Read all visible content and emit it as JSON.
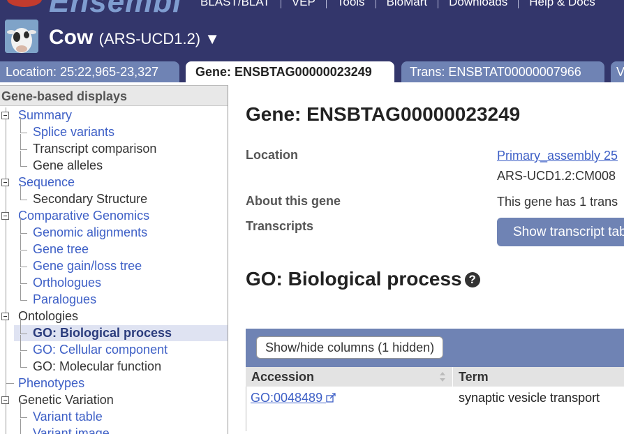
{
  "header": {
    "logo_text": "Ensembl",
    "nav": [
      "BLAST/BLAT",
      "VEP",
      "Tools",
      "BioMart",
      "Downloads",
      "Help & Docs"
    ],
    "species": "Cow",
    "assembly": "(ARS-UCD1.2) ▼"
  },
  "tabs": [
    {
      "label": "Location: 25:22,965-23,327",
      "active": false
    },
    {
      "label": "Gene: ENSBTAG00000023249",
      "active": true
    },
    {
      "label": "Trans: ENSBTAT00000007966",
      "active": false
    },
    {
      "label": "V",
      "active": false
    }
  ],
  "sidebar": {
    "header": "Gene-based displays",
    "items": [
      {
        "label": "Summary",
        "level": 0,
        "link": true
      },
      {
        "label": "Splice variants",
        "level": 1,
        "link": true
      },
      {
        "label": "Transcript comparison",
        "level": 1,
        "link": false
      },
      {
        "label": "Gene alleles",
        "level": 1,
        "link": false
      },
      {
        "label": "Sequence",
        "level": 0,
        "link": true
      },
      {
        "label": "Secondary Structure",
        "level": 1,
        "link": false
      },
      {
        "label": "Comparative Genomics",
        "level": 0,
        "link": true
      },
      {
        "label": "Genomic alignments",
        "level": 1,
        "link": true
      },
      {
        "label": "Gene tree",
        "level": 1,
        "link": true
      },
      {
        "label": "Gene gain/loss tree",
        "level": 1,
        "link": true
      },
      {
        "label": "Orthologues",
        "level": 1,
        "link": true
      },
      {
        "label": "Paralogues",
        "level": 1,
        "link": true
      },
      {
        "label": "Ontologies",
        "level": 0,
        "link": false
      },
      {
        "label": "GO: Biological process",
        "level": 1,
        "link": true,
        "selected": true
      },
      {
        "label": "GO: Cellular component",
        "level": 1,
        "link": true
      },
      {
        "label": "GO: Molecular function",
        "level": 1,
        "link": false
      },
      {
        "label": "Phenotypes",
        "level": 0,
        "link": true
      },
      {
        "label": "Genetic Variation",
        "level": 0,
        "link": false
      },
      {
        "label": "Variant table",
        "level": 1,
        "link": true
      },
      {
        "label": "Variant image",
        "level": 1,
        "link": true
      }
    ]
  },
  "main": {
    "title": "Gene: ENSBTAG00000023249",
    "location_label": "Location",
    "location_link": "Primary_assembly 25",
    "location_sub": "ARS-UCD1.2:CM008",
    "about_label": "About this gene",
    "about_value": "This gene has 1 trans",
    "transcripts_label": "Transcripts",
    "transcripts_button": "Show transcript tab",
    "section_title": "GO: Biological process",
    "help_icon": "?",
    "columns_button": "Show/hide columns (1 hidden)",
    "table": {
      "headers": [
        "Accession",
        "Term"
      ],
      "rows": [
        [
          "GO:0048489",
          "synaptic vesicle transport"
        ]
      ]
    }
  }
}
